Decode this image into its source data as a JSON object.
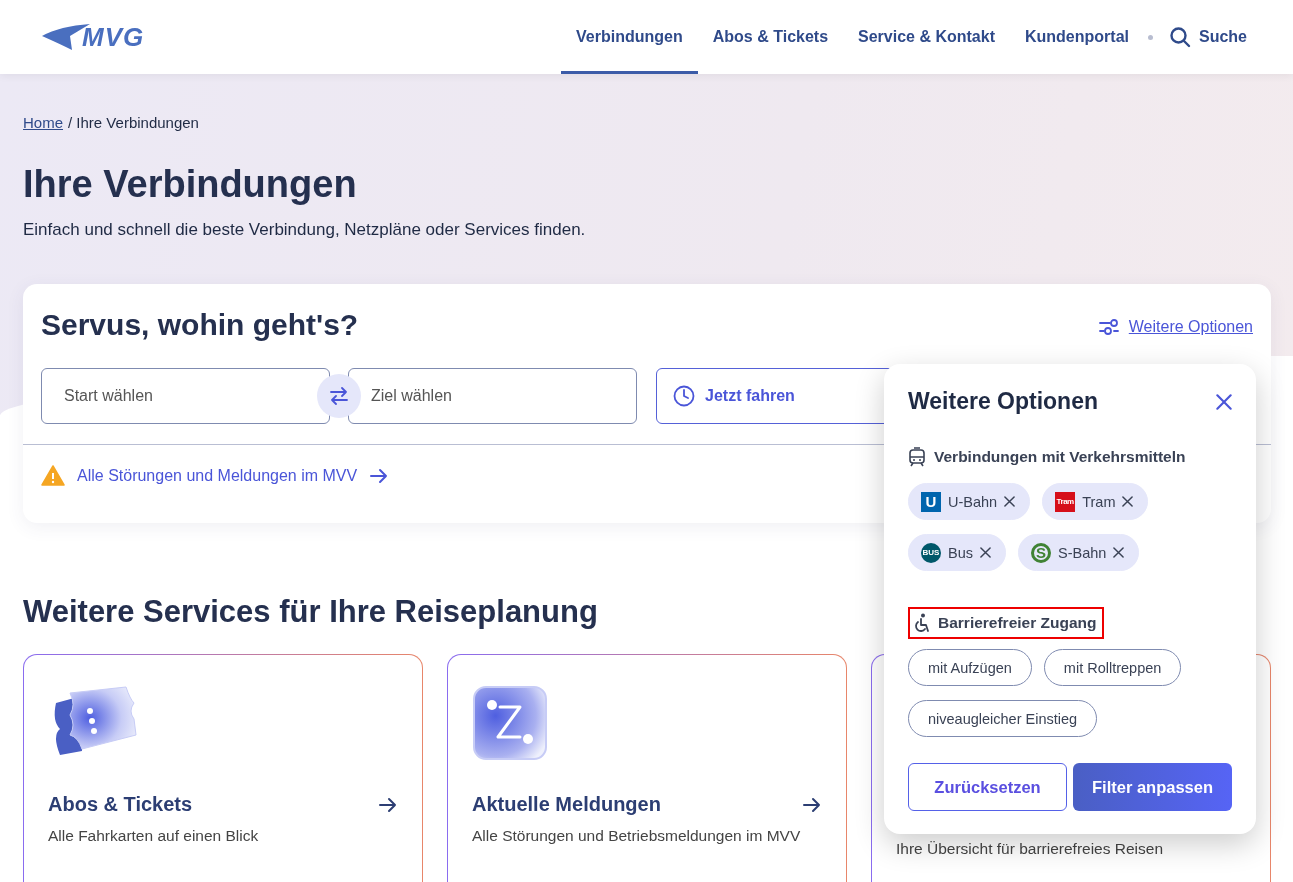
{
  "header": {
    "logo": "MVG",
    "nav": [
      {
        "label": "Verbindungen",
        "selected": true
      },
      {
        "label": "Abos & Tickets",
        "selected": false
      },
      {
        "label": "Service & Kontakt",
        "selected": false
      },
      {
        "label": "Kundenportal",
        "selected": false
      }
    ],
    "search": "Suche"
  },
  "breadcrumb": {
    "home": "Home",
    "current": "/ Ihre Verbindungen"
  },
  "page_title": "Ihre Verbindungen",
  "subtitle": "Einfach und schnell die beste Verbindung, Netzpläne oder Services finden.",
  "search_card": {
    "title": "Servus, wohin geht's?",
    "options_link": "Weitere Optionen",
    "start": {
      "placeholder": "Start wählen"
    },
    "destination": {
      "placeholder": "Ziel wählen"
    },
    "time": "Jetzt fahren",
    "alert": "Alle Störungen und Meldungen im MVV"
  },
  "services": {
    "title": "Weitere Services für Ihre Reiseplanung",
    "cards": [
      {
        "kind": "tickets",
        "title": "Abos & Tickets",
        "description": "Alle Fahrkarten auf einen Blick"
      },
      {
        "kind": "messages",
        "title": "Aktuelle Meldungen",
        "description": "Alle Störungen und Betriebsmeldungen im MVV"
      },
      {
        "kind": "covered",
        "description": "Ihre Übersicht für barrierefreies Reisen"
      }
    ]
  },
  "options_panel": {
    "title": "Weitere Optionen",
    "modes_heading": "Verbindungen mit Verkehrsmitteln",
    "modes": [
      {
        "label": "U-Bahn",
        "badge": "U",
        "kind": "square",
        "color": "#0065ae",
        "selected": true
      },
      {
        "label": "Tram",
        "badge": "Tram",
        "kind": "square",
        "color": "#d60f1a",
        "selected": true
      },
      {
        "label": "Bus",
        "badge": "BUS",
        "kind": "circle",
        "color": "#00586a",
        "selected": true
      },
      {
        "label": "S-Bahn",
        "badge": "S",
        "kind": "ring",
        "color": "#408335",
        "selected": true
      }
    ],
    "access_heading": "Barrierefreier Zugang",
    "access_highlighted": true,
    "access": [
      {
        "label": "mit Aufzügen",
        "selected": false
      },
      {
        "label": "mit Rolltreppen",
        "selected": false
      },
      {
        "label": "niveaugleicher Einstieg",
        "selected": false
      }
    ],
    "reset": "Zurücksetzen",
    "apply": "Filter anpassen"
  }
}
